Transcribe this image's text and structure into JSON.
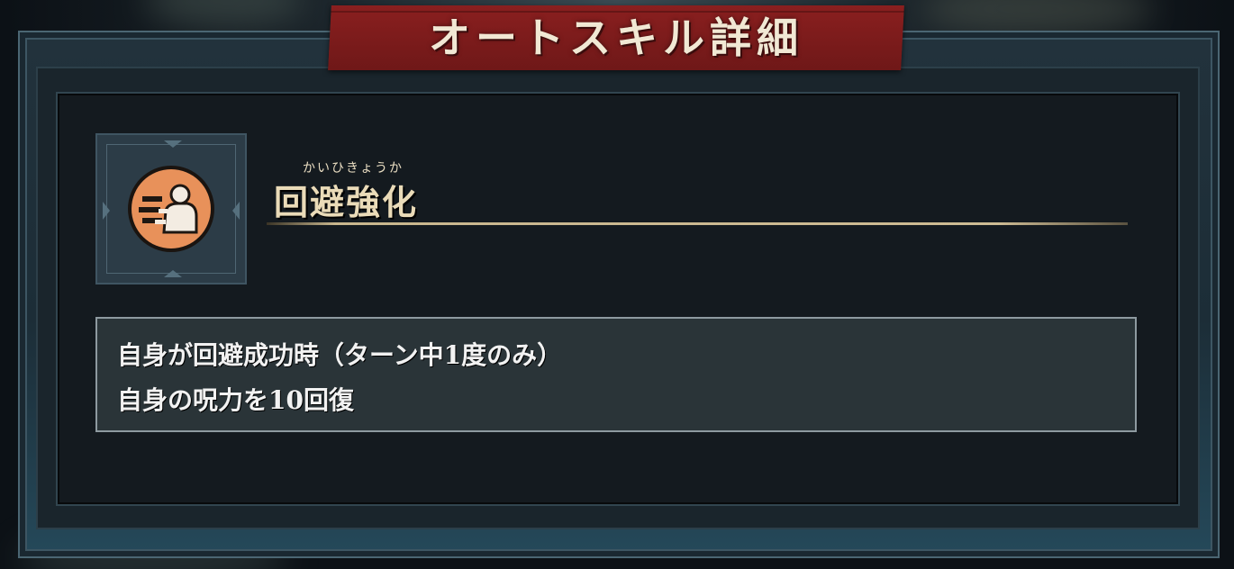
{
  "dialog": {
    "title": "オートスキル詳細"
  },
  "skill": {
    "icon": "dodge-boost-icon",
    "icon_color": "#e8915a",
    "name_ruby": "かいひきょうか",
    "name": "回避強化",
    "description": [
      "自身が回避成功時（ターン中1度のみ）",
      "自身の呪力を10回復"
    ]
  },
  "colors": {
    "banner": "#7a1c1c",
    "name_text": "#eadbb8",
    "frame": "#1c2d37"
  }
}
